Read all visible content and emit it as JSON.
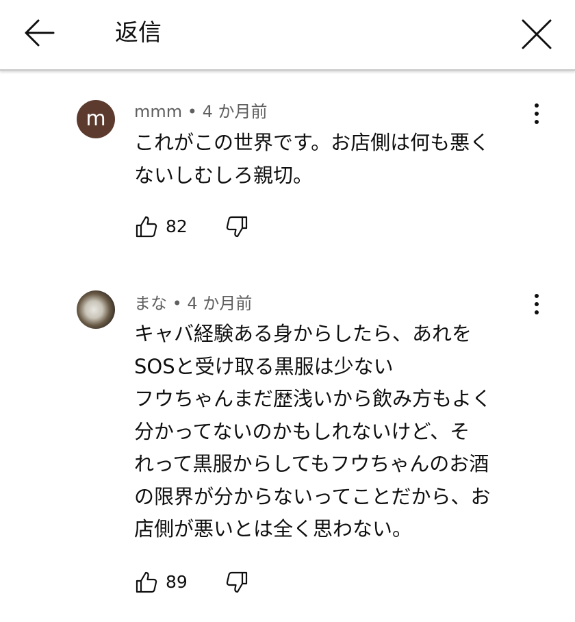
{
  "header": {
    "title": "返信",
    "back_icon": "arrow-left-icon",
    "close_icon": "close-icon"
  },
  "comments": [
    {
      "author": "mmm",
      "separator": " • ",
      "time": "4 か月前",
      "avatar_letter": "m",
      "avatar_color": "#5c3b2e",
      "lines": [
        "これがこの世界です。お店側は何も悪く",
        "ないしむしろ親切。"
      ],
      "likes": "82"
    },
    {
      "author": "まな",
      "separator": " • ",
      "time": "4 か月前",
      "lines": [
        "キャバ経験ある身からしたら、あれを",
        "SOSと受け取る黒服は少ない",
        "フウちゃんまだ歴浅いから飲み方もよく",
        "分かってないのかもしれないけど、そ",
        "れって黒服からしてもフウちゃんのお酒",
        "の限界が分からないってことだから、お",
        "店側が悪いとは全く思わない。"
      ],
      "likes": "89"
    }
  ]
}
